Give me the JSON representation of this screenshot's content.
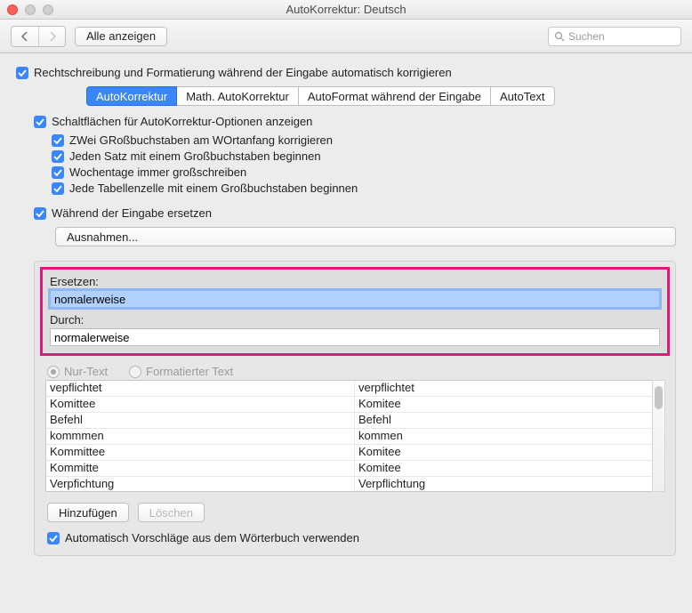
{
  "window": {
    "title": "AutoKorrektur: Deutsch"
  },
  "toolbar": {
    "show_all": "Alle anzeigen",
    "search_placeholder": "Suchen"
  },
  "top_checkbox": "Rechtschreibung und Formatierung während der Eingabe automatisch korrigieren",
  "tabs": {
    "autokorrektur": "AutoKorrektur",
    "math": "Math. AutoKorrektur",
    "autoformat": "AutoFormat während der Eingabe",
    "autotext": "AutoText"
  },
  "options": {
    "show_buttons": "Schaltflächen für AutoKorrektur-Optionen anzeigen",
    "two_caps": "ZWei GRoßbuchstaben am WOrtanfang korrigieren",
    "sentence_cap": "Jeden Satz mit einem Großbuchstaben beginnen",
    "weekdays": "Wochentage immer großschreiben",
    "table_cell": "Jede Tabellenzelle mit einem Großbuchstaben beginnen"
  },
  "replace_while_typing": "Während der Eingabe ersetzen",
  "exceptions_button": "Ausnahmen...",
  "fields": {
    "replace_label": "Ersetzen:",
    "replace_value": "nomalerweise",
    "with_label": "Durch:",
    "with_value": "normalerweise"
  },
  "radios": {
    "plain": "Nur-Text",
    "formatted": "Formatierter Text"
  },
  "table_rows": [
    {
      "from": "vepflichtet",
      "to": "verpflichtet"
    },
    {
      "from": "Komittee",
      "to": "Komitee"
    },
    {
      "from": "Befehl",
      "to": "Befehl"
    },
    {
      "from": "kommmen",
      "to": "kommen"
    },
    {
      "from": "Kommittee",
      "to": "Komitee"
    },
    {
      "from": "Kommitte",
      "to": "Komitee"
    },
    {
      "from": "Verpfichtung",
      "to": "Verpflichtung"
    }
  ],
  "buttons": {
    "add": "Hinzufügen",
    "delete": "Löschen"
  },
  "auto_suggest": "Automatisch Vorschläge aus dem Wörterbuch verwenden"
}
